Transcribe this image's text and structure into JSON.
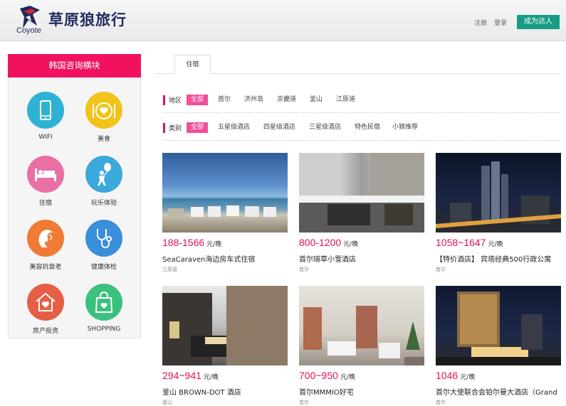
{
  "header": {
    "logo_text_en": "Coyote",
    "logo_text_cn": "草原狼旅行",
    "register_label": "注册",
    "login_label": "登录",
    "become_expert_label": "成为达人",
    "brand_color": "#169c86"
  },
  "sidebar": {
    "title": "韩国咨询横块",
    "items": [
      {
        "label": "WIFI",
        "icon": "phone-icon",
        "color": "#2fb1d6"
      },
      {
        "label": "美食",
        "icon": "plate-heart-icon",
        "color": "#f2c318"
      },
      {
        "label": "住宿",
        "icon": "bed-icon",
        "color": "#e96fa5"
      },
      {
        "label": "玩乐体验",
        "icon": "balloon-person-icon",
        "color": "#3aa9dc"
      },
      {
        "label": "美容抗衰老",
        "icon": "woman-profile-icon",
        "color": "#f07b34"
      },
      {
        "label": "健康体检",
        "icon": "stethoscope-icon",
        "color": "#3a8fdb"
      },
      {
        "label": "房产投资",
        "icon": "house-heart-icon",
        "color": "#e55e46"
      },
      {
        "label": "SHOPPING",
        "icon": "shopping-bag-icon",
        "color": "#3cc07f"
      }
    ]
  },
  "tabs": [
    {
      "label": "住宿"
    }
  ],
  "filters": {
    "region": {
      "label": "地区",
      "options": [
        "全部",
        "首尔",
        "济州岛",
        "京畿道",
        "釜山",
        "江原道"
      ],
      "selected": "全部"
    },
    "category": {
      "label": "类别",
      "options": [
        "全部",
        "五星级酒店",
        "四星级酒店",
        "三星级酒店",
        "特色民宿",
        "小狼推荐"
      ],
      "selected": "全部"
    }
  },
  "listings": [
    {
      "price": "188-1566",
      "unit": "元/晚",
      "title": "SeaCaraven海边房车式住宿",
      "location": "江原道",
      "image": "beach-caravans-image"
    },
    {
      "price": "800-1200",
      "unit": "元/晚",
      "title": "首尔瑞草小雪酒店",
      "location": "首尔",
      "image": "hotel-entrance-image"
    },
    {
      "price": "1058~1647",
      "unit": "元/晚",
      "title": "【特价酒店】 宾塔经典500行政公寓",
      "location": "首尔",
      "image": "night-skyline-image"
    },
    {
      "price": "294~941",
      "unit": "元/晚",
      "title": "釜山 BROWN-DOT 酒店",
      "location": "釜山",
      "image": "hotel-street-image"
    },
    {
      "price": "700~950",
      "unit": "元/晚",
      "title": "首尔MMMIO好宅",
      "location": "首尔",
      "image": "living-room-image"
    },
    {
      "price": "1046",
      "unit": "元/晚",
      "title": "首尔大使联合会铂尔曼大酒店（Grand",
      "location": "首尔",
      "image": "hotel-night-image"
    }
  ],
  "colors": {
    "accent_pink": "#e0115f",
    "sidebar_header": "#f0125f"
  }
}
